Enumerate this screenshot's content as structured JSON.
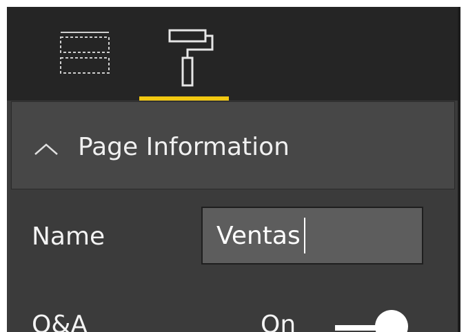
{
  "toolbar": {
    "tabs": [
      {
        "icon": "fields-icon",
        "active": false
      },
      {
        "icon": "paint-roller-icon",
        "active": true
      }
    ],
    "accent_color": "#f2c811"
  },
  "section": {
    "title": "Page Information",
    "expanded": true
  },
  "fields": {
    "name_label": "Name",
    "name_value": "Ventas",
    "qa_label": "Q&A",
    "qa_state": "On",
    "qa_enabled": true
  }
}
